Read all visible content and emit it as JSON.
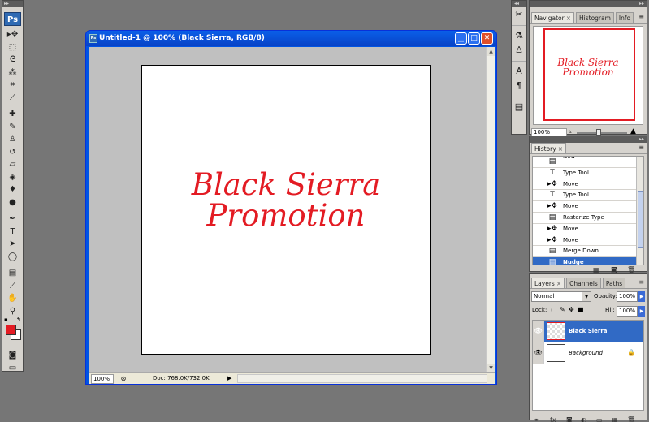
{
  "app": {
    "logo": "Ps"
  },
  "tools": [
    {
      "name": "move-tool",
      "glyph": "▸✥"
    },
    {
      "name": "marquee-tool",
      "glyph": "⬚"
    },
    {
      "name": "lasso-tool",
      "glyph": "ᘓ"
    },
    {
      "name": "magic-wand-tool",
      "glyph": "⁂"
    },
    {
      "name": "crop-tool",
      "glyph": "⌗"
    },
    {
      "name": "slice-tool",
      "glyph": "⟋"
    },
    {
      "name": "healing-brush-tool",
      "glyph": "✚"
    },
    {
      "name": "brush-tool",
      "glyph": "✎"
    },
    {
      "name": "clone-stamp-tool",
      "glyph": "♙"
    },
    {
      "name": "history-brush-tool",
      "glyph": "↺"
    },
    {
      "name": "eraser-tool",
      "glyph": "▱"
    },
    {
      "name": "paint-bucket-tool",
      "glyph": "◈"
    },
    {
      "name": "blur-tool",
      "glyph": "♦"
    },
    {
      "name": "dodge-tool",
      "glyph": "●"
    },
    {
      "name": "pen-tool",
      "glyph": "✒"
    },
    {
      "name": "type-tool",
      "glyph": "T"
    },
    {
      "name": "path-selection-tool",
      "glyph": "➤"
    },
    {
      "name": "shape-tool",
      "glyph": "◯"
    },
    {
      "name": "notes-tool",
      "glyph": "▤"
    },
    {
      "name": "eyedropper-tool",
      "glyph": "⟋"
    },
    {
      "name": "hand-tool",
      "glyph": "✋"
    },
    {
      "name": "zoom-tool",
      "glyph": "⚲"
    }
  ],
  "colors": {
    "foreground": "#e31b23",
    "background": "#ffffff",
    "selection": "#316ac5"
  },
  "document": {
    "title": "Untitled-1 @ 100% (Black Sierra, RGB/8)",
    "canvas_line1": "Black Sierra",
    "canvas_line2": "Promotion",
    "zoom": "100%",
    "doc_info": "Doc: 768.0K/732.0K"
  },
  "navigator": {
    "tabs": [
      "Navigator",
      "Histogram",
      "Info"
    ],
    "preview_line1": "Black Sierra",
    "preview_line2": "Promotion",
    "zoom": "100%"
  },
  "history": {
    "tab": "History",
    "items": [
      {
        "label": "New",
        "icon": "▤"
      },
      {
        "label": "Type Tool",
        "icon": "T"
      },
      {
        "label": "Move",
        "icon": "▸✥"
      },
      {
        "label": "Type Tool",
        "icon": "T"
      },
      {
        "label": "Move",
        "icon": "▸✥"
      },
      {
        "label": "Rasterize Type",
        "icon": "▤"
      },
      {
        "label": "Move",
        "icon": "▸✥"
      },
      {
        "label": "Move",
        "icon": "▸✥"
      },
      {
        "label": "Merge Down",
        "icon": "▤"
      },
      {
        "label": "Nudge",
        "icon": "▤"
      }
    ]
  },
  "layers": {
    "tabs": [
      "Layers",
      "Channels",
      "Paths"
    ],
    "blend_mode": "Normal",
    "opacity_label": "Opacity:",
    "opacity": "100%",
    "lock_label": "Lock:",
    "fill_label": "Fill:",
    "fill": "100%",
    "items": [
      {
        "name": "Black Sierra"
      },
      {
        "name": "Background"
      }
    ]
  }
}
